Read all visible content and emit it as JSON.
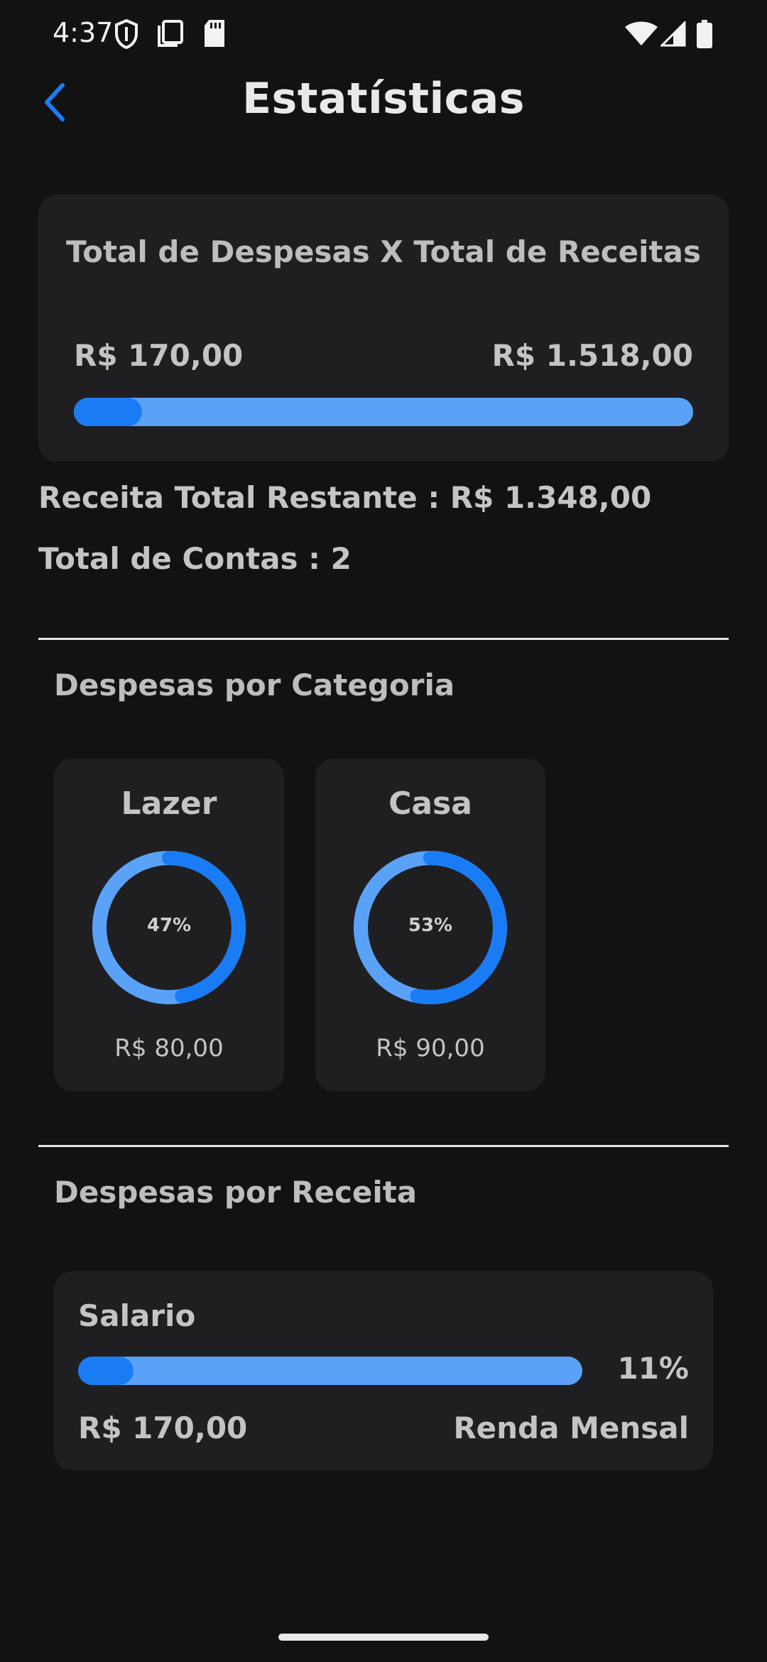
{
  "status_bar": {
    "time": "4:37",
    "left_icons": [
      "shield-icon",
      "screenshot-icon",
      "sd-card-icon"
    ],
    "right_icons": [
      "wifi-icon",
      "cell-signal-icon",
      "battery-icon"
    ]
  },
  "header": {
    "title": "Estatísticas",
    "back_icon": "chevron-left-icon",
    "accent_color": "#1a7cf5"
  },
  "summary": {
    "title": "Total de Despesas X Total de Receitas",
    "expenses": "R$ 170,00",
    "income": "R$ 1.518,00",
    "expense_fraction": 0.11,
    "remaining_line": "Receita Total Restante : R$ 1.348,00",
    "accounts_line": "Total de Contas : 2"
  },
  "categories": {
    "title": "Despesas por Categoria",
    "items": [
      {
        "name": "Lazer",
        "percent_label": "47%",
        "percent": 47,
        "amount": "R$  80,00"
      },
      {
        "name": "Casa",
        "percent_label": "53%",
        "percent": 53,
        "amount": "R$  90,00"
      }
    ]
  },
  "by_income": {
    "title": "Despesas por Receita",
    "items": [
      {
        "name": "Salario",
        "percent_label": "11%",
        "percent": 11,
        "amount": "R$ 170,00",
        "type": "Renda Mensal"
      }
    ]
  },
  "colors": {
    "background": "#121212",
    "card": "#1f1f21",
    "progress_track": "#5aa2f8",
    "progress_fill": "#1a7cf5"
  }
}
